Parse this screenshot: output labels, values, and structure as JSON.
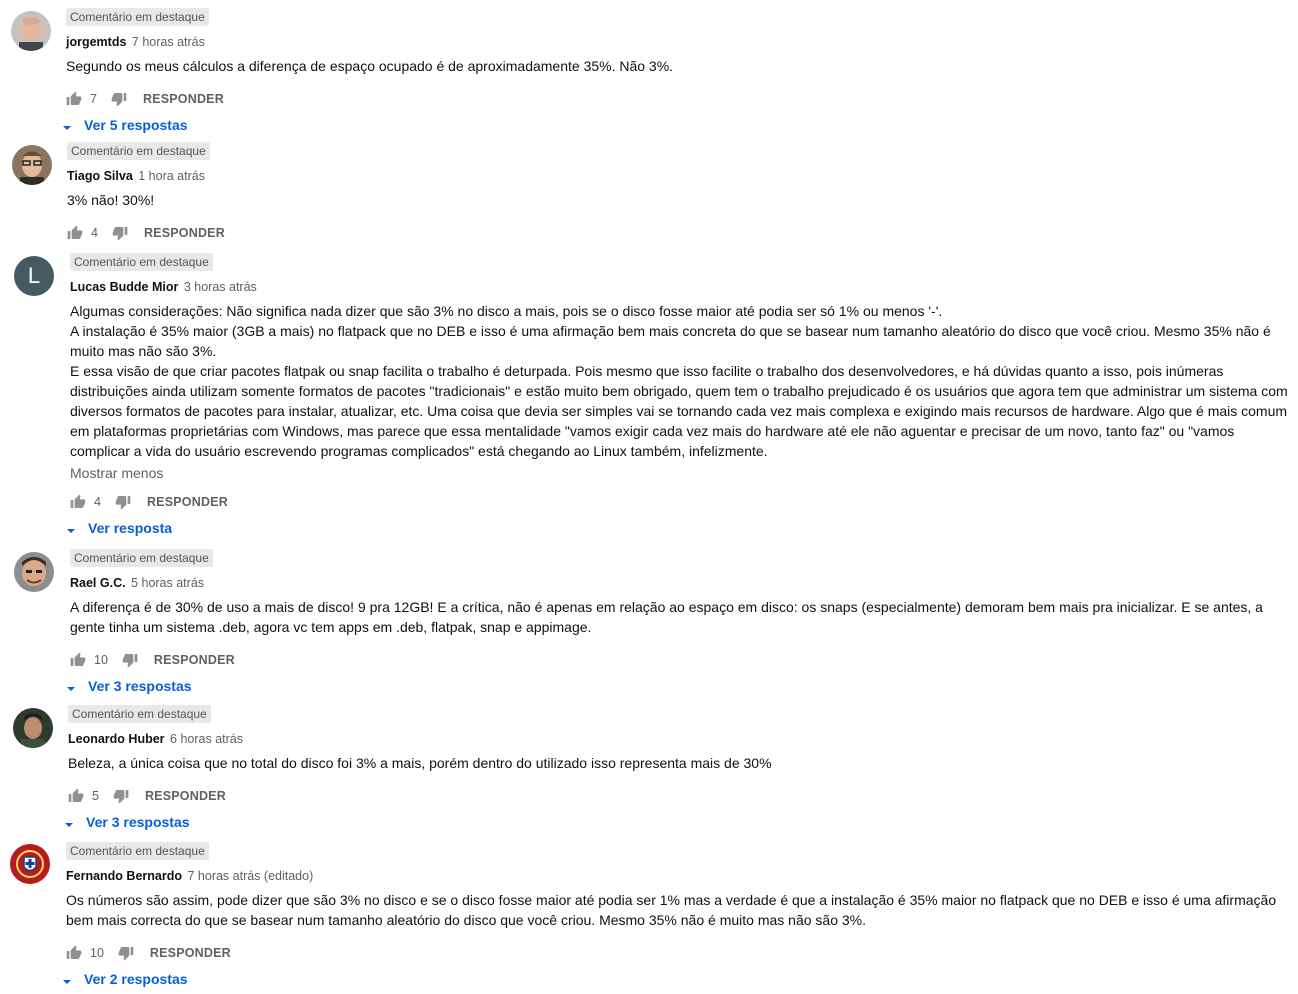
{
  "colors": {
    "link": "#065fd4",
    "muted": "#606060",
    "pinned_bg": "#e8e8e8"
  },
  "comments": [
    {
      "pinned": "Comentário em destaque",
      "author": "jorgemtds",
      "time": "7 horas atrás",
      "text": "Segundo os meus cálculos a diferença de espaço ocupado é de aproximadamente 35%. Não 3%.",
      "likes": "7",
      "reply": "RESPONDER",
      "replies": "Ver 5 respostas",
      "avatar_icon": "avatar-bald-man"
    },
    {
      "pinned": "Comentário em destaque",
      "author": "Tiago Silva",
      "time": "1 hora atrás",
      "text": "3% não! 30%!",
      "likes": "4",
      "reply": "RESPONDER",
      "avatar_icon": "avatar-glasses-man"
    },
    {
      "pinned": "Comentário em destaque",
      "author": "Lucas Budde Mior",
      "time": "3 horas atrás",
      "avatar_letter": "L",
      "text_lines": [
        "Algumas considerações: Não significa nada dizer que são 3% no disco a mais, pois se o disco fosse maior até podia ser só 1% ou menos '-'.",
        "A instalação é 35% maior (3GB a mais) no flatpack que no DEB e isso é uma afirmação bem mais concreta do que se basear num tamanho aleatório do disco que você criou. Mesmo 35% não é muito mas não são 3%.",
        "E essa visão de que criar pacotes flatpak ou snap facilita o trabalho é deturpada. Pois mesmo que isso facilite o trabalho dos desenvolvedores, e há dúvidas quanto a isso, pois inúmeras distribuições ainda utilizam somente formatos de pacotes \"tradicionais\" e estão muito bem obrigado, quem tem o trabalho prejudicado é os usuários que agora tem que administrar um sistema com diversos formatos de pacotes para instalar, atualizar, etc. Uma coisa que devia ser simples vai se tornando cada vez mais complexa e exigindo mais recursos de hardware. Algo que é mais comum em plataformas proprietárias com Windows, mas parece que essa mentalidade \"vamos exigir cada vez mais do hardware até ele não aguentar e precisar de um novo, tanto faz\" ou \"vamos complicar a vida do usuário escrevendo programas complicados\" está chegando ao Linux também, infelizmente."
      ],
      "show_less": "Mostrar menos",
      "likes": "4",
      "reply": "RESPONDER",
      "replies": "Ver resposta"
    },
    {
      "pinned": "Comentário em destaque",
      "author": "Rael G.C.",
      "time": "5 horas atrás",
      "text": "A diferença é de 30% de uso a mais de disco! 9 pra 12GB! E a crítica, não é apenas em relação ao espaço em disco: os snaps (especialmente) demoram bem mais pra inicializar. E se antes, a gente tinha um sistema .deb, agora vc tem apps em .deb, flatpak, snap e appimage.",
      "likes": "10",
      "reply": "RESPONDER",
      "replies": "Ver 3 respostas",
      "avatar_icon": "avatar-smiling-man"
    },
    {
      "pinned": "Comentário em destaque",
      "author": "Leonardo Huber",
      "time": "6 horas atrás",
      "text": "Beleza, a única coisa que no total do disco foi 3% a mais, porém dentro do utilizado isso representa mais de 30%",
      "likes": "5",
      "reply": "RESPONDER",
      "replies": "Ver 3 respostas",
      "avatar_icon": "avatar-dark-photo"
    },
    {
      "pinned": "Comentário em destaque",
      "author": "Fernando Bernardo",
      "time": "7 horas atrás (editado)",
      "text": "Os números são assim, pode dizer que são 3% no disco e se o disco fosse maior até podia ser 1% mas a verdade é que a instalação é 35% maior no flatpack que no DEB e isso é uma afirmação bem mais correcta do que se basear num tamanho aleatório do disco que você criou. Mesmo 35% não é muito mas não são 3%.",
      "likes": "10",
      "reply": "RESPONDER",
      "replies": "Ver 2 respostas",
      "avatar_icon": "avatar-crest"
    }
  ]
}
